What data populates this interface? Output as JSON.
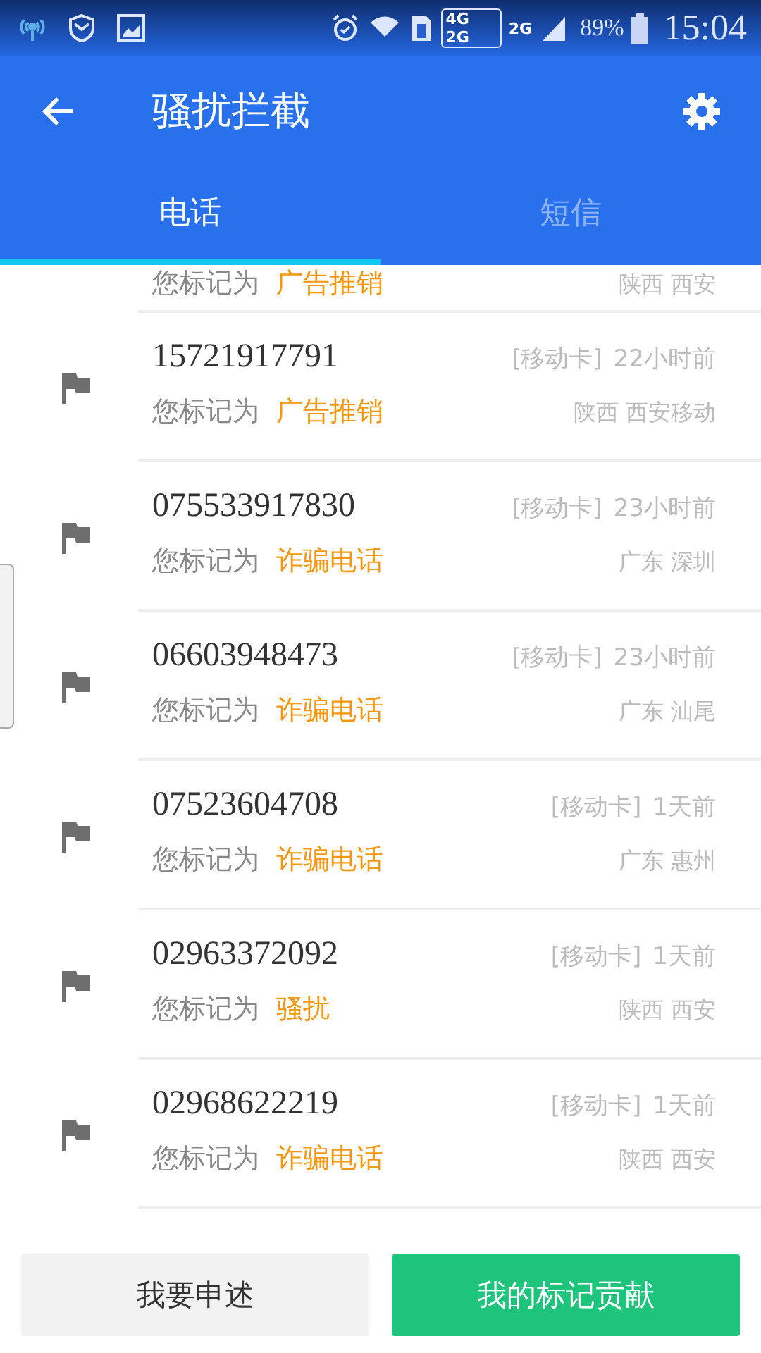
{
  "status_bar": {
    "network_4g": "4G",
    "network_2g_a": "2G",
    "network_2g_b": "2G",
    "battery": "89%",
    "time": "15:04"
  },
  "app_bar": {
    "title": "骚扰拦截"
  },
  "tabs": [
    {
      "label": "电话",
      "selected": true
    },
    {
      "label": "短信",
      "selected": false
    }
  ],
  "records": [
    {
      "kind": "cut",
      "label": "您标记为",
      "tag": "广告推销",
      "location": "陕西 西安"
    },
    {
      "number": "15721917791",
      "sim": "[移动卡]",
      "time": "22小时前",
      "label": "您标记为",
      "tag": "广告推销",
      "location": "陕西 西安移动"
    },
    {
      "number": "075533917830",
      "sim": "[移动卡]",
      "time": "23小时前",
      "label": "您标记为",
      "tag": "诈骗电话",
      "location": "广东 深圳"
    },
    {
      "number": "06603948473",
      "sim": "[移动卡]",
      "time": "23小时前",
      "label": "您标记为",
      "tag": "诈骗电话",
      "location": "广东 汕尾"
    },
    {
      "number": "07523604708",
      "sim": "[移动卡]",
      "time": "1天前",
      "label": "您标记为",
      "tag": "诈骗电话",
      "location": "广东 惠州"
    },
    {
      "number": "02963372092",
      "sim": "[移动卡]",
      "time": "1天前",
      "label": "您标记为",
      "tag": "骚扰",
      "location": "陕西 西安"
    },
    {
      "number": "02968622219",
      "sim": "[移动卡]",
      "time": "1天前",
      "label": "您标记为",
      "tag": "诈骗电话",
      "location": "陕西 西安"
    }
  ],
  "buttons": [
    {
      "label": "我要申述",
      "kind": "secondary"
    },
    {
      "label": "我的标记贡献",
      "kind": "primary"
    }
  ]
}
